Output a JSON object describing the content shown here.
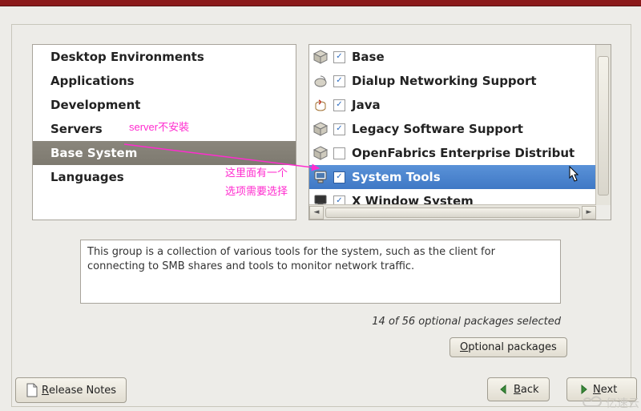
{
  "categories": {
    "items": [
      {
        "label": "Desktop Environments"
      },
      {
        "label": "Applications"
      },
      {
        "label": "Development"
      },
      {
        "label": "Servers"
      },
      {
        "label": "Base System"
      },
      {
        "label": "Languages"
      }
    ],
    "selected_index": 4
  },
  "packages": {
    "items": [
      {
        "label": "Base",
        "checked": true,
        "icon": "box"
      },
      {
        "label": "Dialup Networking Support",
        "checked": true,
        "icon": "modem"
      },
      {
        "label": "Java",
        "checked": true,
        "icon": "java"
      },
      {
        "label": "Legacy Software Support",
        "checked": true,
        "icon": "box"
      },
      {
        "label": "OpenFabrics Enterprise Distribut",
        "checked": false,
        "icon": "box"
      },
      {
        "label": "System Tools",
        "checked": true,
        "icon": "computer"
      },
      {
        "label": "X Window System",
        "checked": true,
        "icon": "screen"
      }
    ],
    "selected_index": 5
  },
  "description": "This group is a collection of various tools for the system, such as the client for connecting to SMB shares and tools to monitor network traffic.",
  "optional_count": {
    "selected": 14,
    "total": 56,
    "text": "14 of 56 optional packages selected"
  },
  "buttons": {
    "optional_packages": {
      "underline": "O",
      "rest": "ptional packages"
    },
    "release_notes": {
      "underline": "R",
      "rest": "elease Notes"
    },
    "back": {
      "underline": "B",
      "rest": "ack"
    },
    "next": {
      "underline": "N",
      "rest": "ext"
    }
  },
  "annotations": {
    "server_note": "server不安裝",
    "list_note_line1": "这里面有一个",
    "list_note_line2": "选项需要选择"
  },
  "watermark": "亿速云"
}
